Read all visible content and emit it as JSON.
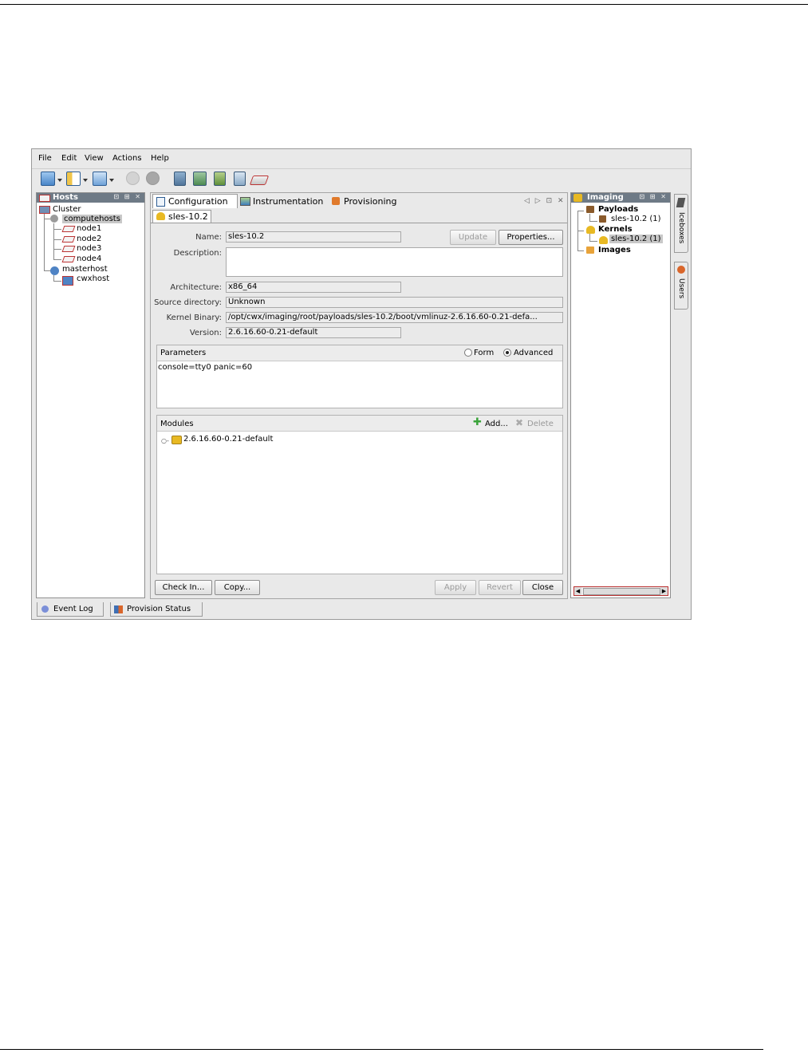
{
  "menu": {
    "file": "File",
    "edit": "Edit",
    "view": "View",
    "actions": "Actions",
    "help": "Help"
  },
  "hosts_panel": {
    "title": "Hosts",
    "controls": "⊡ ⊞ ✕",
    "tree": {
      "root": "Cluster",
      "group1": "computehosts",
      "nodes": [
        "node1",
        "node2",
        "node3",
        "node4"
      ],
      "group2": "masterhost",
      "master_child": "cwxhost"
    }
  },
  "center": {
    "tabs": {
      "configuration": "Configuration",
      "instrumentation": "Instrumentation",
      "provisioning": "Provisioning"
    },
    "nav_controls": "◁ ▷ ⊡ ✕",
    "doc_tab": "sles-10.2",
    "form": {
      "name_label": "Name:",
      "name_value": "sles-10.2",
      "description_label": "Description:",
      "description_value": "",
      "architecture_label": "Architecture:",
      "architecture_value": "x86_64",
      "source_label": "Source directory:",
      "source_value": "Unknown",
      "kernel_label": "Kernel Binary:",
      "kernel_value": "/opt/cwx/imaging/root/payloads/sles-10.2/boot/vmlinuz-2.6.16.60-0.21-defa...",
      "version_label": "Version:",
      "version_value": "2.6.16.60-0.21-default"
    },
    "update_button": "Update",
    "properties_button": "Properties...",
    "parameters": {
      "title": "Parameters",
      "form_option": "Form",
      "advanced_option": "Advanced",
      "value": "console=tty0 panic=60"
    },
    "modules": {
      "title": "Modules",
      "add": "Add...",
      "delete": "Delete",
      "items": [
        "2.6.16.60-0.21-default"
      ]
    },
    "buttons": {
      "check_in": "Check In...",
      "copy": "Copy...",
      "apply": "Apply",
      "revert": "Revert",
      "close": "Close"
    }
  },
  "imaging_panel": {
    "title": "Imaging",
    "controls": "⊡ ⊞ ✕",
    "tree": {
      "payloads": "Payloads",
      "payload_item": "sles-10.2 (1)",
      "kernels": "Kernels",
      "kernel_item": "sles-10.2 (1)",
      "images": "Images"
    }
  },
  "side_tabs": {
    "iceboxes": "Iceboxes",
    "users": "Users"
  },
  "bottom_tabs": {
    "event_log": "Event Log",
    "provision_status": "Provision Status"
  },
  "colors": {
    "title_bar": "#6e7a86",
    "selection": "#c8c8c8",
    "node_red": "#bb3333",
    "folder_yellow": "#e8b923",
    "add_green": "#3aa33a"
  }
}
